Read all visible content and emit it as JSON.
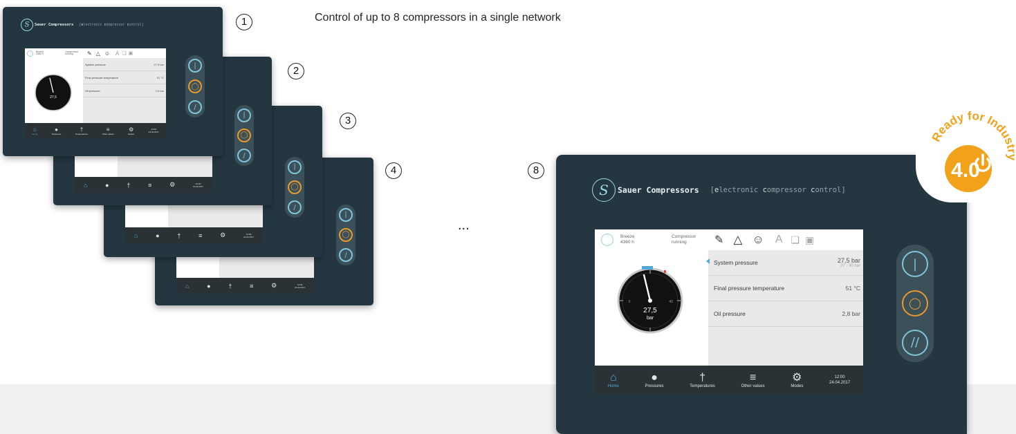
{
  "headline": "Control of up to 8 compressors in a single network",
  "markers": {
    "m1": "1",
    "m2": "2",
    "m3": "3",
    "m4": "4",
    "m8": "8"
  },
  "ellipsis": "...",
  "brand": {
    "name": "Sauer Compressors",
    "sub_prefix": "[",
    "sub_e1": "e",
    "sub_w1": "lectronic ",
    "sub_e2": "c",
    "sub_w2": "ompressor ",
    "sub_e3": "c",
    "sub_w3": "ontrol]"
  },
  "status": {
    "mode_name": "Breeze",
    "mode_value": "4360 h",
    "compressor_state": "Compressor running"
  },
  "toolbar": {
    "font_label": "A"
  },
  "gauge": {
    "value": "27,5",
    "unit": "bar",
    "needle_fraction": 0.45,
    "scale_low": "0",
    "scale_high": "40"
  },
  "values": [
    {
      "label": "System pressure",
      "value": "27,5 bar",
      "sub": "27 - 30 bar"
    },
    {
      "label": "Final pressure temperature",
      "value": "51 °C"
    },
    {
      "label": "Oil pressure",
      "value": "2,8 bar"
    }
  ],
  "nav": [
    {
      "label": "Home",
      "icon": "home-icon"
    },
    {
      "label": "Pressures",
      "icon": "gauge-icon"
    },
    {
      "label": "Temperatures",
      "icon": "thermometer-icon"
    },
    {
      "label": "Other values",
      "icon": "list-icon"
    },
    {
      "label": "Modes",
      "icon": "gear-icon"
    }
  ],
  "clock": {
    "time": "12:00",
    "date": "24.04.2017"
  },
  "badge": {
    "text": "Ready for Industry",
    "number": "4.0"
  },
  "colors": {
    "housing": "#243740",
    "accent_blue": "#7fc6dc",
    "accent_orange": "#e89a2c",
    "badge": "#f2a11a"
  }
}
